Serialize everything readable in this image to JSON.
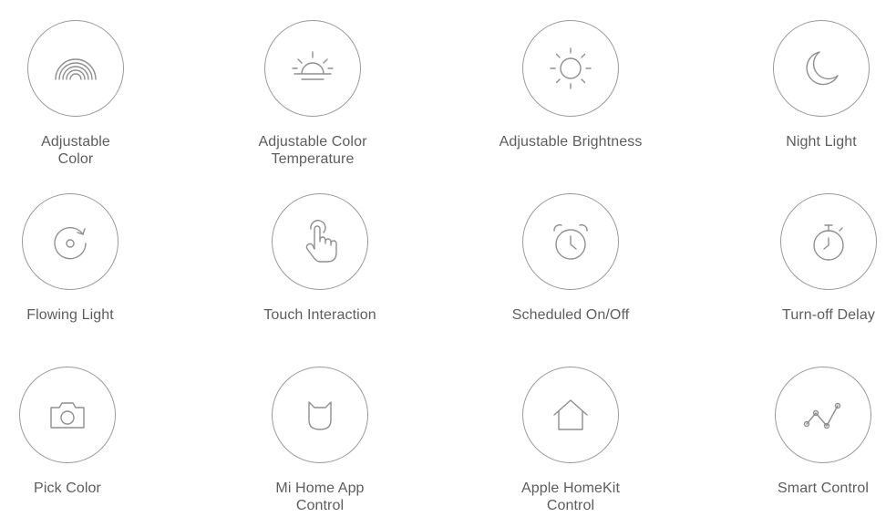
{
  "features": [
    {
      "icon": "rainbow-icon",
      "lines": [
        "Adjustable",
        "Color"
      ]
    },
    {
      "icon": "sunrise-icon",
      "lines": [
        "Adjustable Color",
        "Temperature"
      ]
    },
    {
      "icon": "sun-icon",
      "lines": [
        "Adjustable Brightness"
      ]
    },
    {
      "icon": "moon-icon",
      "lines": [
        "Night Light"
      ]
    },
    {
      "icon": "refresh-icon",
      "lines": [
        "Flowing Light"
      ]
    },
    {
      "icon": "touch-hand-icon",
      "lines": [
        "Touch Interaction"
      ]
    },
    {
      "icon": "alarm-clock-icon",
      "lines": [
        "Scheduled On/Off"
      ]
    },
    {
      "icon": "stopwatch-icon",
      "lines": [
        "Turn-off Delay"
      ]
    },
    {
      "icon": "camera-icon",
      "lines": [
        "Pick Color"
      ]
    },
    {
      "icon": "mi-home-icon",
      "lines": [
        "Mi Home App",
        "Control"
      ]
    },
    {
      "icon": "homekit-house-icon",
      "lines": [
        "Apple HomeKit",
        "Control"
      ]
    },
    {
      "icon": "smart-control-icon",
      "lines": [
        "Smart Control"
      ]
    }
  ]
}
